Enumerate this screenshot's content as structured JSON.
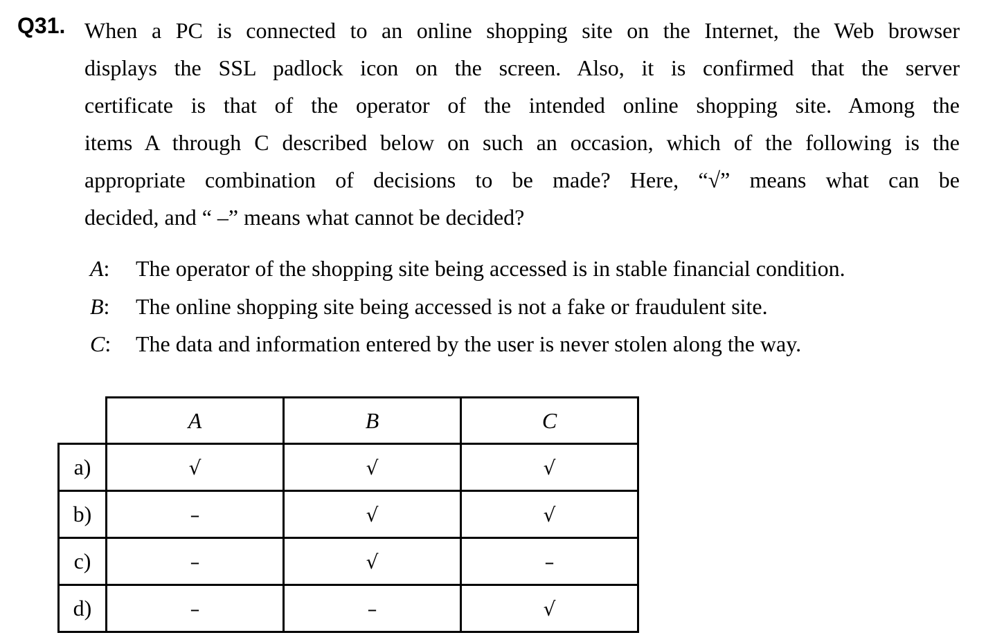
{
  "question": {
    "number": "Q31.",
    "lines": [
      "When a PC is connected to an online shopping site on the Internet, the Web browser",
      "displays the SSL padlock icon on the screen.  Also, it is confirmed that the server",
      "certificate is that of the operator of the intended online shopping site.  Among the",
      "items A through C described below on such an occasion, which of the following is the",
      "appropriate combination of decisions to be made?  Here, “√” means what can be",
      "decided, and “ –” means what cannot be decided?"
    ]
  },
  "items": [
    {
      "letter": "A",
      "text": "The operator of the shopping site being accessed is in stable financial condition."
    },
    {
      "letter": "B",
      "text": "The online shopping site being accessed is not a fake or fraudulent site."
    },
    {
      "letter": "C",
      "text": "The data and information entered by the user is never stolen along the way."
    }
  ],
  "table": {
    "headers": [
      "A",
      "B",
      "C"
    ],
    "rows": [
      {
        "label": "a)",
        "cells": [
          "√",
          "√",
          "√"
        ]
      },
      {
        "label": "b)",
        "cells": [
          "–",
          "√",
          "√"
        ]
      },
      {
        "label": "c)",
        "cells": [
          "–",
          "√",
          "–"
        ]
      },
      {
        "label": "d)",
        "cells": [
          "–",
          "–",
          "√"
        ]
      }
    ]
  }
}
